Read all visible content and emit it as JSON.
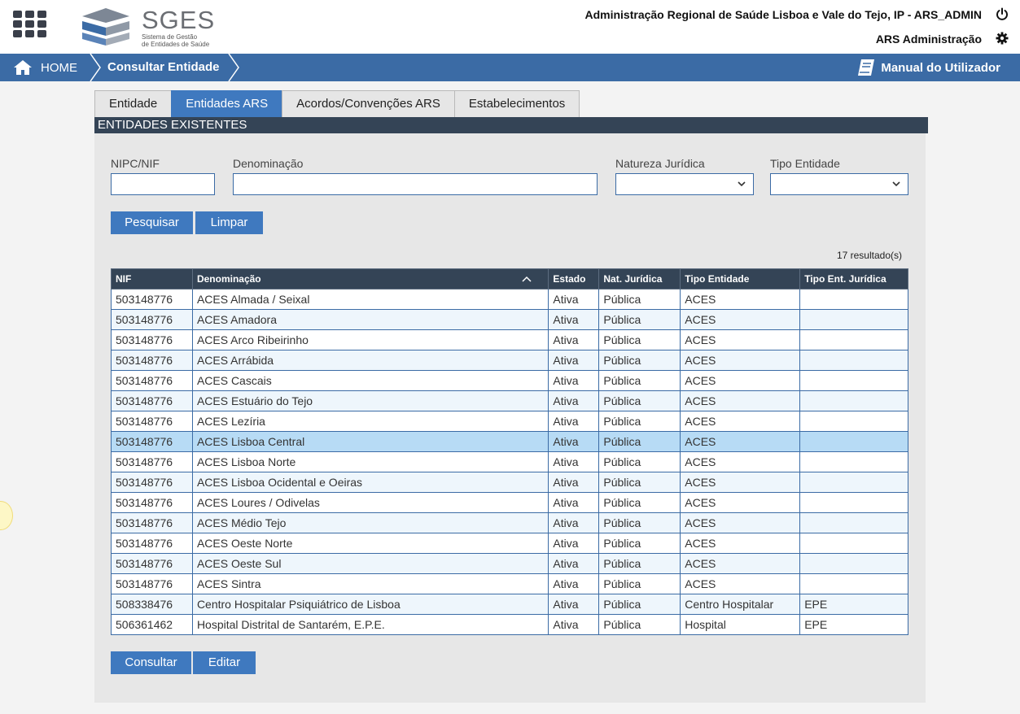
{
  "header": {
    "app_title": "SGES",
    "app_subtitle_line1": "Sistema de Gestão",
    "app_subtitle_line2": "de Entidades de Saúde",
    "organization": "Administração Regional de Saúde Lisboa e Vale do Tejo, IP - ARS_ADMIN",
    "user_role": "ARS Administração",
    "icons": [
      "apps-grid-icon",
      "power-icon",
      "gear-icon"
    ]
  },
  "nav": {
    "home_label": "HOME",
    "current_page": "Consultar Entidade",
    "manual_label": "Manual do Utilizador"
  },
  "tabs": [
    {
      "label": "Entidade",
      "active": false
    },
    {
      "label": "Entidades ARS",
      "active": true
    },
    {
      "label": "Acordos/Convenções ARS",
      "active": false
    },
    {
      "label": "Estabelecimentos",
      "active": false
    }
  ],
  "section_title": "ENTIDADES EXISTENTES",
  "filters": {
    "nif_label": "NIPC/NIF",
    "nif_value": "",
    "denominacao_label": "Denominação",
    "denominacao_value": "",
    "natureza_label": "Natureza Jurídica",
    "natureza_value": "",
    "tipo_label": "Tipo Entidade",
    "tipo_value": ""
  },
  "buttons": {
    "search": "Pesquisar",
    "clear": "Limpar",
    "view": "Consultar",
    "edit": "Editar"
  },
  "result_count": "17 resultado(s)",
  "table": {
    "columns": [
      "NIF",
      "Denominação",
      "Estado",
      "Nat. Jurídica",
      "Tipo Entidade",
      "Tipo Ent. Jurídica"
    ],
    "sorted_column": "Denominação",
    "selected_row": 7,
    "rows": [
      [
        "503148776",
        "ACES Almada / Seixal",
        "Ativa",
        "Pública",
        "ACES",
        ""
      ],
      [
        "503148776",
        "ACES Amadora",
        "Ativa",
        "Pública",
        "ACES",
        ""
      ],
      [
        "503148776",
        "ACES Arco Ribeirinho",
        "Ativa",
        "Pública",
        "ACES",
        ""
      ],
      [
        "503148776",
        "ACES Arrábida",
        "Ativa",
        "Pública",
        "ACES",
        ""
      ],
      [
        "503148776",
        "ACES Cascais",
        "Ativa",
        "Pública",
        "ACES",
        ""
      ],
      [
        "503148776",
        "ACES Estuário do Tejo",
        "Ativa",
        "Pública",
        "ACES",
        ""
      ],
      [
        "503148776",
        "ACES Lezíria",
        "Ativa",
        "Pública",
        "ACES",
        ""
      ],
      [
        "503148776",
        "ACES Lisboa Central",
        "Ativa",
        "Pública",
        "ACES",
        ""
      ],
      [
        "503148776",
        "ACES Lisboa Norte",
        "Ativa",
        "Pública",
        "ACES",
        ""
      ],
      [
        "503148776",
        "ACES Lisboa Ocidental e Oeiras",
        "Ativa",
        "Pública",
        "ACES",
        ""
      ],
      [
        "503148776",
        "ACES Loures / Odivelas",
        "Ativa",
        "Pública",
        "ACES",
        ""
      ],
      [
        "503148776",
        "ACES Médio Tejo",
        "Ativa",
        "Pública",
        "ACES",
        ""
      ],
      [
        "503148776",
        "ACES Oeste Norte",
        "Ativa",
        "Pública",
        "ACES",
        ""
      ],
      [
        "503148776",
        "ACES Oeste Sul",
        "Ativa",
        "Pública",
        "ACES",
        ""
      ],
      [
        "503148776",
        "ACES Sintra",
        "Ativa",
        "Pública",
        "ACES",
        ""
      ],
      [
        "508338476",
        "Centro Hospitalar Psiquiátrico de Lisboa",
        "Ativa",
        "Pública",
        "Centro Hospitalar",
        "EPE"
      ],
      [
        "506361462",
        "Hospital Distrital de Santarém, E.P.E.",
        "Ativa",
        "Pública",
        "Hospital",
        "EPE"
      ]
    ]
  },
  "colors": {
    "nav_blue": "#3b6ba5",
    "button_blue": "#3f79bf",
    "header_dark": "#344456",
    "row_selected": "#b7dbf5",
    "row_alt": "#eef6fc"
  }
}
